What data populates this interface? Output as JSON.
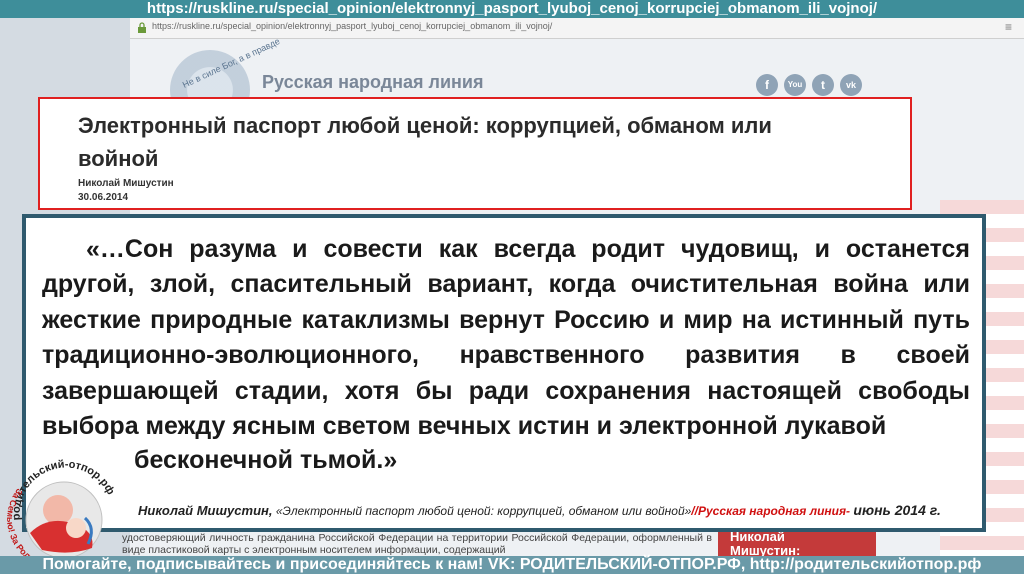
{
  "top_url": "https://ruskline.ru/special_opinion/elektronnyj_pasport_lyuboj_cenoj_korrupciej_obmanom_ili_vojnoj/",
  "browser": {
    "address": "https://ruskline.ru/special_opinion/elektronnyj_pasport_lyuboj_cenoj_korrupciej_obmanom_ili_vojnoj/"
  },
  "site": {
    "name": "Русская народная линия",
    "emblem_text": "Не в силе Бог, а в правде",
    "social": [
      "f",
      "You",
      "t",
      "vk"
    ]
  },
  "article": {
    "title": "Электронный паспорт любой ценой: коррупцией, обманом или войной",
    "author": "Николай Мишустин",
    "date": "30.06.2014"
  },
  "quote": {
    "text": "«…Сон разума и совести как всегда родит чудовищ, и останется другой, злой, спасительный вариант, когда очистительная война или жесткие природные катаклизмы вернут Россию и мир на истинный путь традиционно-эволюционного, нравственного развития в своей завершающей стадии, хотя бы ради сохранения настоящей свободы выбора между ясным светом вечных истин и электронной лукавой",
    "end": "бесконечной тьмой.»",
    "source_author": "Николай Мишустин,",
    "source_title": "«Электронный паспорт любой ценой: коррупцией, обманом или войной»",
    "source_site": "//Русская народная линия-",
    "source_date": "июнь 2014 г."
  },
  "below_text": "удостоверяющий личность гражданина Российской Федерации на территории Российской Федерации, оформленный в виде пластиковой карты с электронным носителем информации, содержащий",
  "sidebar": {
    "line1": "Николай",
    "line2": "Мишустин:"
  },
  "logo": {
    "text_top": "родительский-отпор.рф",
    "text_side": "За Семью! За Родину! За Традиции!"
  },
  "bottom_banner": "Помогайте, подписывайтесь и присоединяйтесь к нам! VK: РОДИТЕЛЬСКИЙ-ОТПОР.РФ, http://родительскийотпор.рф"
}
